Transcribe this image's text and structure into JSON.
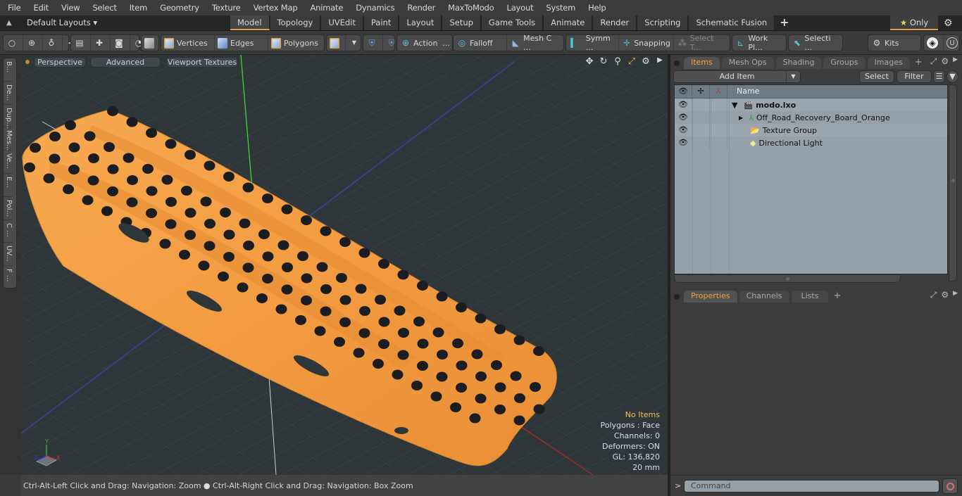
{
  "menubar": {
    "items": [
      "File",
      "Edit",
      "View",
      "Select",
      "Item",
      "Geometry",
      "Texture",
      "Vertex Map",
      "Animate",
      "Dynamics",
      "Render",
      "MaxToModo",
      "Layout",
      "System",
      "Help"
    ]
  },
  "layoutbar": {
    "layouts_label": "Default Layouts ▾",
    "tabs": [
      "Model",
      "Topology",
      "UVEdit",
      "Paint",
      "Layout",
      "Setup",
      "Game Tools",
      "Animate",
      "Render",
      "Scripting",
      "Schematic Fusion"
    ],
    "active_tab": "Model",
    "add_tab": "+",
    "only_label": "Only",
    "only_icon": "★"
  },
  "toolbar": {
    "vertices": "Vertices",
    "edges": "Edges",
    "polygons": "Polygons",
    "action": "Action",
    "action_more": "...",
    "falloff": "Falloff",
    "mesh_c": "Mesh C ...",
    "symm": "Symm ...",
    "snapping": "Snapping",
    "select_t": "Select T...",
    "work_pl": "Work Pl...",
    "selecti": "Selecti ...",
    "kits": "Kits"
  },
  "left_tabs": [
    "B...",
    "De...",
    "Dup...",
    "Mes...",
    "Ve...",
    "E...",
    "Pol...",
    "C ...",
    "UV...",
    "F ..."
  ],
  "viewport": {
    "perspective": "Perspective",
    "advanced": "Advanced",
    "viewport_textures": "Viewport Textures",
    "hud": {
      "selection": "No Items",
      "polygons": "Polygons : Face",
      "channels": "Channels: 0",
      "deformers": "Deformers: ON",
      "gl": "GL: 136,820",
      "scale": "20 mm"
    },
    "gizmo": {
      "x": "X",
      "y": "Y",
      "z": "Z"
    },
    "model_color": "#f3a04a"
  },
  "statusbar": {
    "hint_left": "Ctrl-Alt-Left Click and Drag: Navigation: Zoom",
    "hint_right": "Ctrl-Alt-Right Click and Drag: Navigation: Box Zoom"
  },
  "items_panel": {
    "tabs": [
      "Items",
      "Mesh Ops",
      "Shading",
      "Groups",
      "Images"
    ],
    "active_tab": "Items",
    "add_item": "Add Item",
    "select": "Select",
    "filter": "Filter",
    "column_name": "Name",
    "rows": [
      {
        "label": "modo.lxo",
        "expander": "▼",
        "icon": "scene-icon",
        "bold": true
      },
      {
        "label": "Off_Road_Recovery_Board_Orange",
        "expander": "▶",
        "icon": "mesh-locator-icon"
      },
      {
        "label": "Texture Group",
        "expander": "",
        "icon": "folder-icon"
      },
      {
        "label": "Directional Light",
        "expander": "",
        "icon": "light-icon"
      }
    ]
  },
  "properties_panel": {
    "tabs": [
      "Properties",
      "Channels",
      "Lists"
    ],
    "active_tab": "Properties"
  },
  "command": {
    "prompt": ">",
    "placeholder": "Command"
  },
  "colors": {
    "accent": "#e4a043",
    "viewport_bg": "#2f363a",
    "tree_bg": "#95a0a8"
  }
}
